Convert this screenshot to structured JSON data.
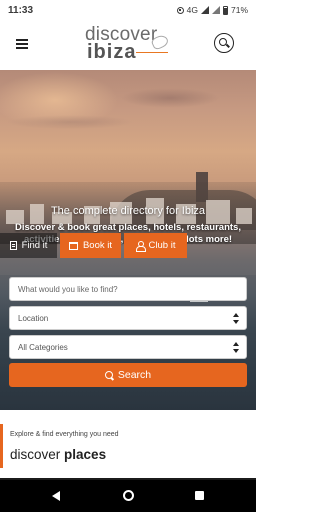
{
  "status_bar": {
    "time": "11:33",
    "network": "4G",
    "battery": "71%"
  },
  "header": {
    "logo_top": "discover",
    "logo_bottom": "ibiza"
  },
  "hero": {
    "title": "The complete directory for Ibiza",
    "subtitle": "Discover & book great places, hotels, restaurants, activities bars, shops, services and lots more!"
  },
  "tabs": [
    {
      "label": "Find it",
      "icon": "document-icon"
    },
    {
      "label": "Book it",
      "icon": "calendar-icon"
    },
    {
      "label": "Club it",
      "icon": "user-icon"
    }
  ],
  "search_form": {
    "keyword_placeholder": "What would you like to find?",
    "location_value": "Location",
    "category_value": "All Categories",
    "submit_label": "Search"
  },
  "explore": {
    "subtitle": "Explore & find everything you need",
    "title_light": "discover",
    "title_bold": "places"
  },
  "colors": {
    "accent": "#e6661f"
  }
}
